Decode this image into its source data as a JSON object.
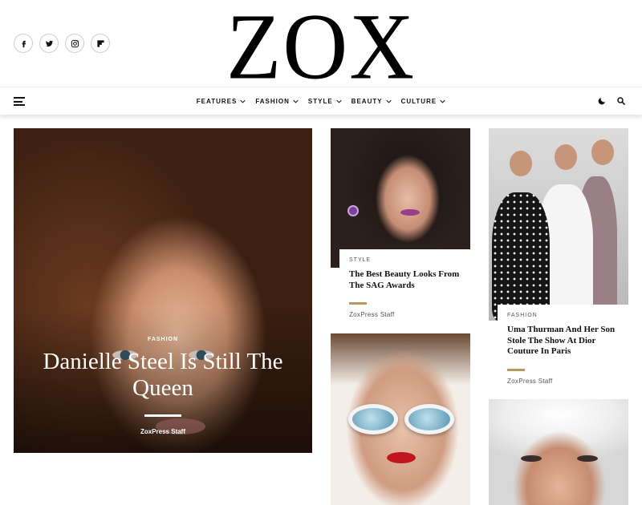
{
  "header": {
    "logo": "ZOX",
    "social": [
      {
        "icon": "facebook-icon"
      },
      {
        "icon": "twitter-icon"
      },
      {
        "icon": "instagram-icon"
      },
      {
        "icon": "flipboard-icon"
      }
    ]
  },
  "nav": {
    "items": [
      {
        "label": "FEATURES"
      },
      {
        "label": "FASHION"
      },
      {
        "label": "STYLE"
      },
      {
        "label": "BEAUTY"
      },
      {
        "label": "CULTURE"
      }
    ],
    "icons": [
      "hamburger-menu-icon",
      "dark-mode-moon-icon",
      "search-icon"
    ]
  },
  "hero": {
    "category": "FASHION",
    "title": "Danielle Steel Is Still The Queen",
    "author": "ZoxPress Staff"
  },
  "cards": [
    {
      "category": "STYLE",
      "title": "The Best Beauty Looks From The SAG Awards",
      "author": "ZoxPress Staff"
    },
    {
      "category": "FASHION",
      "title": "Uma Thurman And Her Son Stole The Show At Dior Couture In Paris",
      "author": "ZoxPress Staff"
    }
  ],
  "colors": {
    "accent_rule": "#b89a5e",
    "text": "#111111",
    "background": "#ffffff"
  }
}
